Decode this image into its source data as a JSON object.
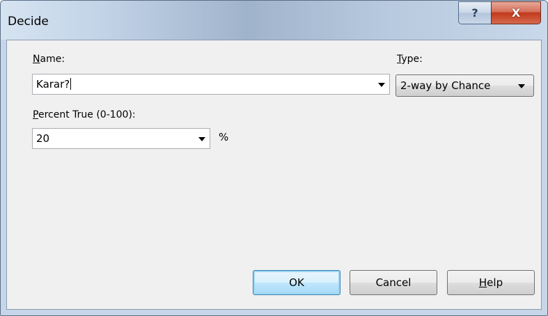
{
  "window": {
    "title": "Decide",
    "help_glyph": "?",
    "close_glyph": "X"
  },
  "form": {
    "name_label_key": "N",
    "name_label_rest": "ame:",
    "name_value": "Karar?",
    "type_label_key": "T",
    "type_label_rest": "ype:",
    "type_value": "2-way by Chance",
    "percent_label_key": "P",
    "percent_label_rest": "ercent True (0-100):",
    "percent_value": "20",
    "percent_unit": "%"
  },
  "buttons": {
    "ok": "OK",
    "cancel": "Cancel",
    "help_key": "H",
    "help_rest": "elp"
  }
}
